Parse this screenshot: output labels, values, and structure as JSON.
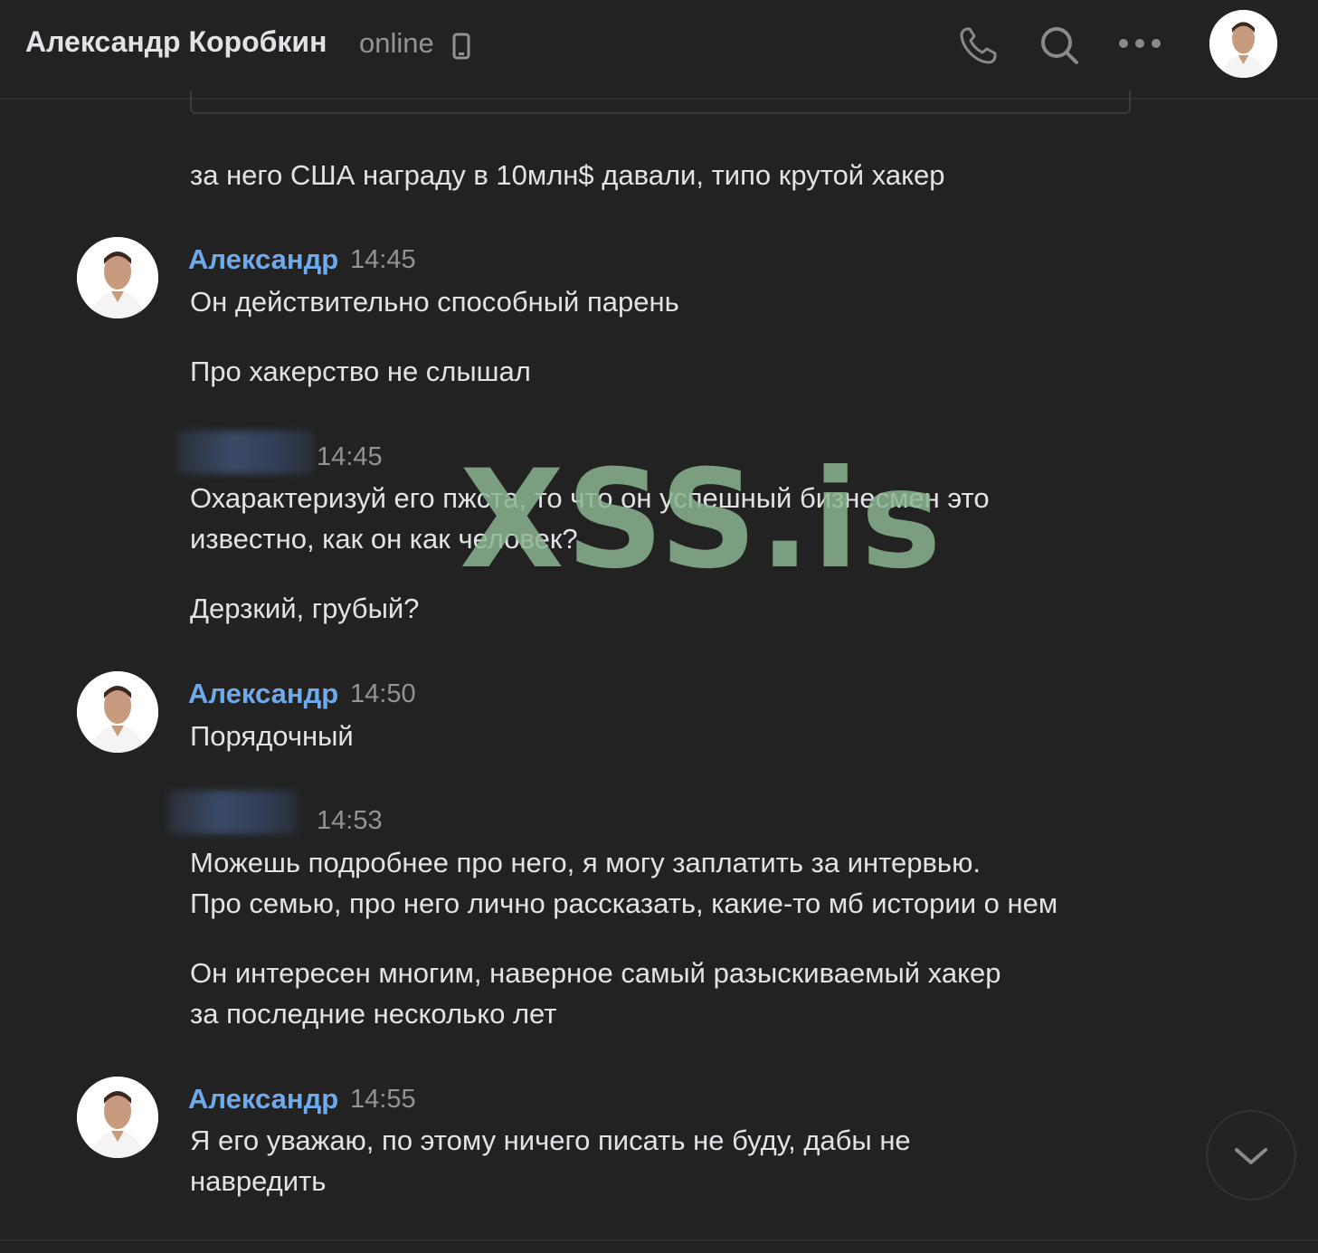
{
  "header": {
    "contact_name": "Александр Коробкин",
    "status": "online",
    "icons": [
      "mobile-icon",
      "phone-icon",
      "search-icon",
      "more-icon",
      "avatar"
    ]
  },
  "messages": [
    {
      "text": "за него США награду в 10млн$ давали, типо крутой хакер"
    },
    {
      "author": "Александр",
      "time": "14:45",
      "text": "Он действительно способный парень"
    },
    {
      "text": "Про хакерство не слышал"
    },
    {
      "time": "14:45",
      "text": "Охарактеризуй его пжста, то что он успешный бизнесмен это\nизвестно, как он как человек?"
    },
    {
      "text": "Дерзкий, грубый?"
    },
    {
      "author": "Александр",
      "time": "14:50",
      "text": "Порядочный"
    },
    {
      "time": "14:53",
      "text": "Можешь подробнее про него, я могу заплатить за интервью.\nПро семью, про него лично рассказать, какие-то мб истории о нем"
    },
    {
      "text": "Он интересен многим, наверное самый разыскиваемый хакер\nза последние несколько лет"
    },
    {
      "author": "Александр",
      "time": "14:55",
      "text": "Я его уважаю, по этому ничего писать не буду, дабы не\nнавредить"
    }
  ],
  "watermark": "XSS.is",
  "colors": {
    "background": "#222222",
    "author": "#71aaeb",
    "text": "#e1e3e6",
    "muted": "#939393"
  }
}
